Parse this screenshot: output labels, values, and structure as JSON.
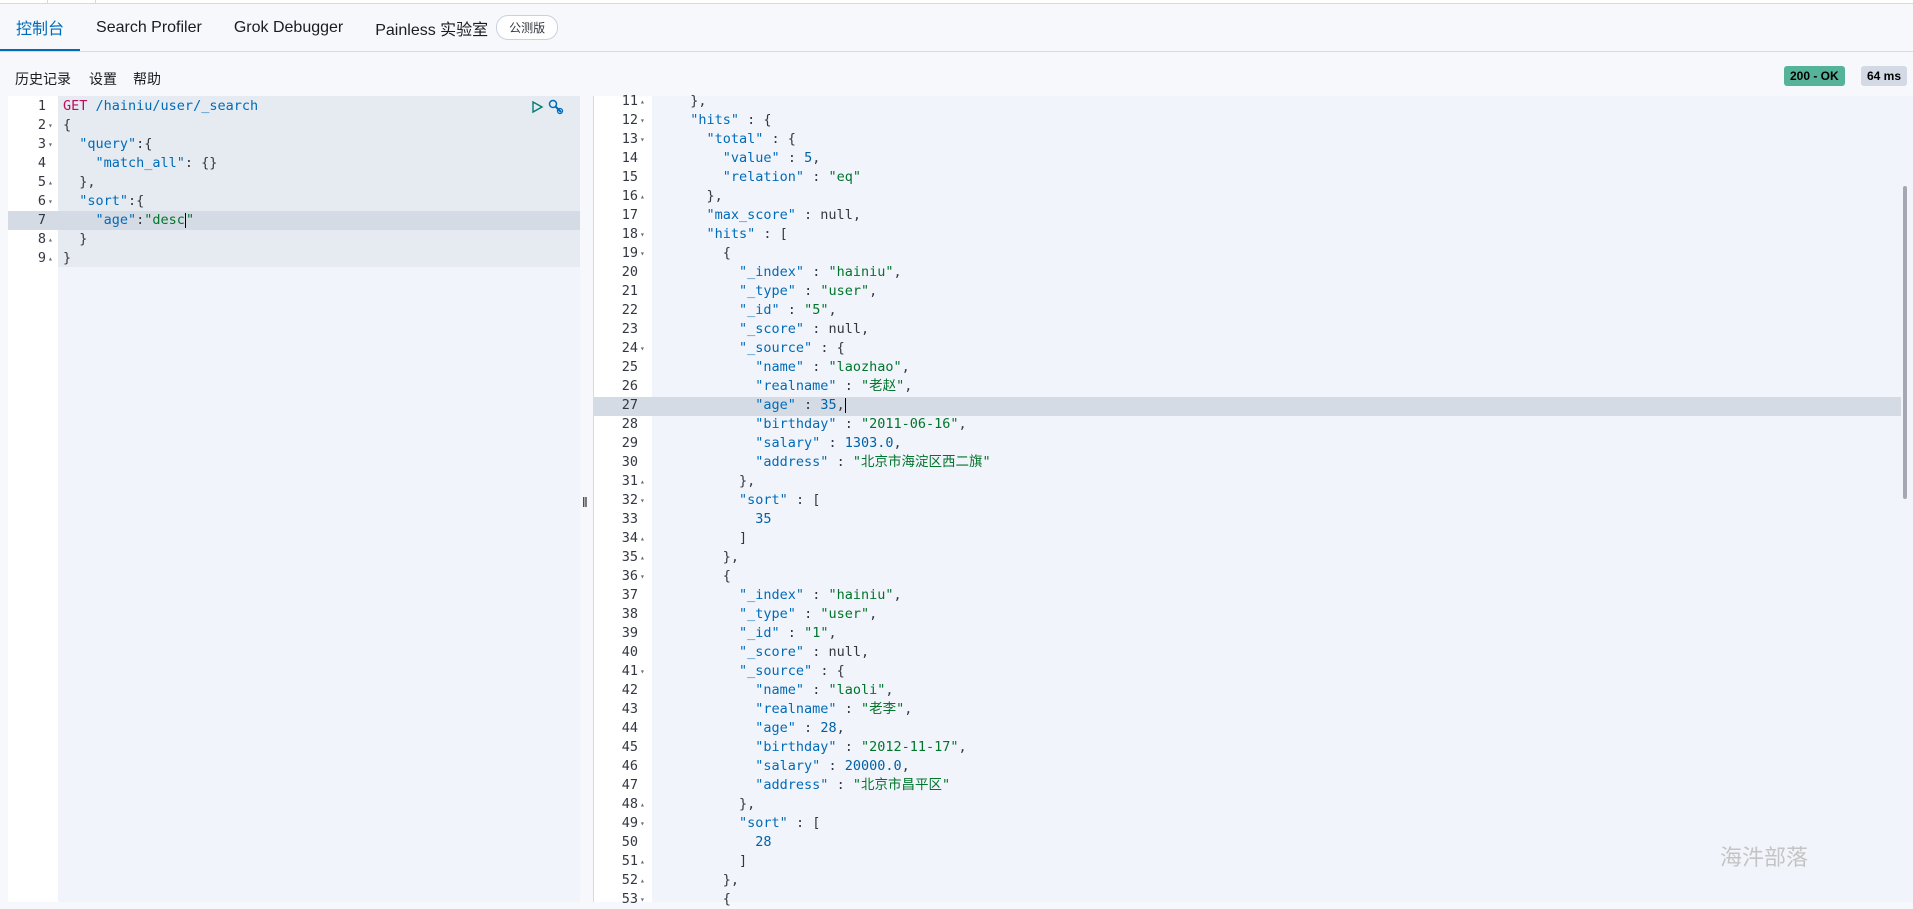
{
  "tabs": [
    {
      "label": "控制台",
      "active": true
    },
    {
      "label": "Search Profiler",
      "active": false
    },
    {
      "label": "Grok Debugger",
      "active": false
    },
    {
      "label": "Painless 实验室",
      "active": false,
      "badge": "公测版"
    }
  ],
  "toolbar": {
    "history": "历史记录",
    "settings": "设置",
    "help": "帮助",
    "status": "200 - OK",
    "duration": "64 ms"
  },
  "request": {
    "lines": [
      {
        "n": "1",
        "fold": "",
        "html": "<span class=\"kw\">GET</span> <span class=\"k\">/hainiu/user/_search</span>"
      },
      {
        "n": "2",
        "fold": "▾",
        "html": "{"
      },
      {
        "n": "3",
        "fold": "▾",
        "html": "  <span class=\"k\">\"query\"</span>:{"
      },
      {
        "n": "4",
        "fold": "",
        "html": "    <span class=\"k\">\"match_all\"</span>: {}"
      },
      {
        "n": "5",
        "fold": "▴",
        "html": "  },"
      },
      {
        "n": "6",
        "fold": "▾",
        "html": "  <span class=\"k\">\"sort\"</span>:{"
      },
      {
        "n": "7",
        "fold": "",
        "html": "    <span class=\"k\">\"age\"</span>:<span class=\"str\">\"desc</span><span class=\"cursor\"></span><span class=\"str\">\"</span>"
      },
      {
        "n": "8",
        "fold": "▴",
        "html": "  }"
      },
      {
        "n": "9",
        "fold": "▴",
        "html": "}"
      }
    ]
  },
  "response": {
    "lines": [
      {
        "n": "11",
        "fold": "▴",
        "html": "  },"
      },
      {
        "n": "12",
        "fold": "▾",
        "html": "  <span class=\"k\">\"hits\"</span> : {"
      },
      {
        "n": "13",
        "fold": "▾",
        "html": "    <span class=\"k\">\"total\"</span> : {"
      },
      {
        "n": "14",
        "fold": "",
        "html": "      <span class=\"k\">\"value\"</span> : <span class=\"num\">5</span>,"
      },
      {
        "n": "15",
        "fold": "",
        "html": "      <span class=\"k\">\"relation\"</span> : <span class=\"str\">\"eq\"</span>"
      },
      {
        "n": "16",
        "fold": "▴",
        "html": "    },"
      },
      {
        "n": "17",
        "fold": "",
        "html": "    <span class=\"k\">\"max_score\"</span> : null,"
      },
      {
        "n": "18",
        "fold": "▾",
        "html": "    <span class=\"k\">\"hits\"</span> : ["
      },
      {
        "n": "19",
        "fold": "▾",
        "html": "      {"
      },
      {
        "n": "20",
        "fold": "",
        "html": "        <span class=\"k\">\"_index\"</span> : <span class=\"str\">\"hainiu\"</span>,"
      },
      {
        "n": "21",
        "fold": "",
        "html": "        <span class=\"k\">\"_type\"</span> : <span class=\"str\">\"user\"</span>,"
      },
      {
        "n": "22",
        "fold": "",
        "html": "        <span class=\"k\">\"_id\"</span> : <span class=\"str\">\"5\"</span>,"
      },
      {
        "n": "23",
        "fold": "",
        "html": "        <span class=\"k\">\"_score\"</span> : null,"
      },
      {
        "n": "24",
        "fold": "▾",
        "html": "        <span class=\"k\">\"_source\"</span> : {"
      },
      {
        "n": "25",
        "fold": "",
        "html": "          <span class=\"k\">\"name\"</span> : <span class=\"str\">\"laozhao\"</span>,"
      },
      {
        "n": "26",
        "fold": "",
        "html": "          <span class=\"k\">\"realname\"</span> : <span class=\"str\">\"老赵\"</span>,"
      },
      {
        "n": "27",
        "fold": "",
        "html": "          <span class=\"k\">\"age\"</span> : <span class=\"num\">35</span>,<span class=\"cursor\"></span>"
      },
      {
        "n": "28",
        "fold": "",
        "html": "          <span class=\"k\">\"birthday\"</span> : <span class=\"str\">\"2011-06-16\"</span>,"
      },
      {
        "n": "29",
        "fold": "",
        "html": "          <span class=\"k\">\"salary\"</span> : <span class=\"num\">1303.0</span>,"
      },
      {
        "n": "30",
        "fold": "",
        "html": "          <span class=\"k\">\"address\"</span> : <span class=\"str\">\"北京市海淀区西二旗\"</span>"
      },
      {
        "n": "31",
        "fold": "▴",
        "html": "        },"
      },
      {
        "n": "32",
        "fold": "▾",
        "html": "        <span class=\"k\">\"sort\"</span> : ["
      },
      {
        "n": "33",
        "fold": "",
        "html": "          <span class=\"num\">35</span>"
      },
      {
        "n": "34",
        "fold": "▴",
        "html": "        ]"
      },
      {
        "n": "35",
        "fold": "▴",
        "html": "      },"
      },
      {
        "n": "36",
        "fold": "▾",
        "html": "      {"
      },
      {
        "n": "37",
        "fold": "",
        "html": "        <span class=\"k\">\"_index\"</span> : <span class=\"str\">\"hainiu\"</span>,"
      },
      {
        "n": "38",
        "fold": "",
        "html": "        <span class=\"k\">\"_type\"</span> : <span class=\"str\">\"user\"</span>,"
      },
      {
        "n": "39",
        "fold": "",
        "html": "        <span class=\"k\">\"_id\"</span> : <span class=\"str\">\"1\"</span>,"
      },
      {
        "n": "40",
        "fold": "",
        "html": "        <span class=\"k\">\"_score\"</span> : null,"
      },
      {
        "n": "41",
        "fold": "▾",
        "html": "        <span class=\"k\">\"_source\"</span> : {"
      },
      {
        "n": "42",
        "fold": "",
        "html": "          <span class=\"k\">\"name\"</span> : <span class=\"str\">\"laoli\"</span>,"
      },
      {
        "n": "43",
        "fold": "",
        "html": "          <span class=\"k\">\"realname\"</span> : <span class=\"str\">\"老李\"</span>,"
      },
      {
        "n": "44",
        "fold": "",
        "html": "          <span class=\"k\">\"age\"</span> : <span class=\"num\">28</span>,"
      },
      {
        "n": "45",
        "fold": "",
        "html": "          <span class=\"k\">\"birthday\"</span> : <span class=\"str\">\"2012-11-17\"</span>,"
      },
      {
        "n": "46",
        "fold": "",
        "html": "          <span class=\"k\">\"salary\"</span> : <span class=\"num\">20000.0</span>,"
      },
      {
        "n": "47",
        "fold": "",
        "html": "          <span class=\"k\">\"address\"</span> : <span class=\"str\">\"北京市昌平区\"</span>"
      },
      {
        "n": "48",
        "fold": "▴",
        "html": "        },"
      },
      {
        "n": "49",
        "fold": "▾",
        "html": "        <span class=\"k\">\"sort\"</span> : ["
      },
      {
        "n": "50",
        "fold": "",
        "html": "          <span class=\"num\">28</span>"
      },
      {
        "n": "51",
        "fold": "▴",
        "html": "        ]"
      },
      {
        "n": "52",
        "fold": "▴",
        "html": "      },"
      },
      {
        "n": "53",
        "fold": "▾",
        "html": "      {"
      }
    ]
  },
  "watermark": "海汼部落"
}
